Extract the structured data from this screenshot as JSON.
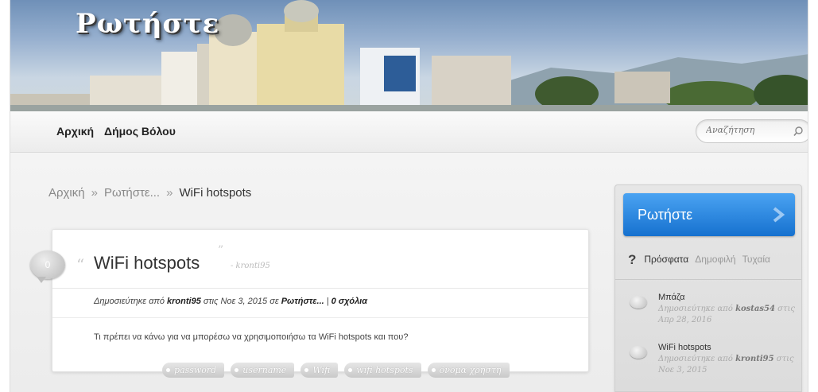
{
  "site": {
    "logo": "Ρωτήστε"
  },
  "nav": {
    "items": [
      "Αρχική",
      "Δήμος Βόλου"
    ]
  },
  "search": {
    "placeholder": "Αναζήτηση"
  },
  "breadcrumb": {
    "home": "Αρχική",
    "section": "Ρωτήστε...",
    "current": "WiFi hotspots",
    "separator": "»"
  },
  "post": {
    "comment_count": "0",
    "title": "WiFi hotspots",
    "author_tag": "- kronti95",
    "meta_prefix": "Δημοσιεύτηκε από ",
    "meta_author": "kronti95",
    "meta_date": " στις Νοε 3, 2015 σε ",
    "meta_category": "Ρωτήστε...",
    "meta_sep": " | ",
    "meta_comments": "0 σχόλια",
    "body": "Τι πρέπει να κάνω για να μπορέσω να χρησιμοποιήσω τα WiFi hotspots και που?",
    "tags": [
      "password",
      "username",
      "Wifi",
      "wifi hotspots",
      "όνομα χρήστη"
    ]
  },
  "sidebar": {
    "ask_button": "Ρωτήστε",
    "tab_icon": "?",
    "tabs": [
      "Πρόσφατα",
      "Δημοφιλή",
      "Τυχαία"
    ],
    "recent": [
      {
        "title": "Μπάζα",
        "by": "Δημοσιεύτηκε από ",
        "author": "kostas54",
        "on": " στις",
        "date": "Απρ 28, 2016"
      },
      {
        "title": "WiFi hotspots",
        "by": "Δημοσιεύτηκε από ",
        "author": "kronti95",
        "on": " στις",
        "date": "Νοε 3, 2015"
      }
    ]
  },
  "colors": {
    "accent_blue": "#1e7fdc",
    "text": "#333333",
    "muted": "#999999"
  }
}
